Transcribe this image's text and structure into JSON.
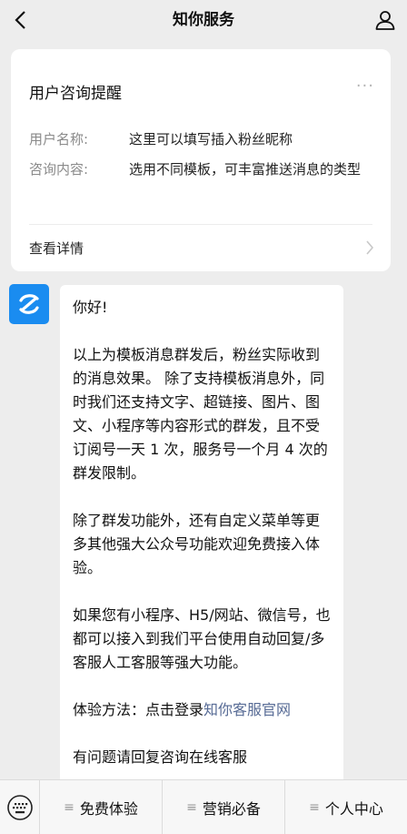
{
  "header": {
    "title": "知你服务"
  },
  "card": {
    "title": "用户咨询提醒",
    "more": "···",
    "fields": [
      {
        "key": "用户名称:",
        "value": "这里可以填写插入粉丝昵称"
      },
      {
        "key": "咨询内容:",
        "value": "选用不同模板，可丰富推送消息的类型"
      }
    ],
    "detail_label": "查看详情"
  },
  "message": {
    "greeting": "你好!",
    "para1": "以上为模板消息群发后，粉丝实际收到的消息效果。 除了支持模板消息外，同时我们还支持文字、超链接、图片、图文、小程序等内容形式的群发，且不受订阅号一天 1 次，服务号一个月 4 次的群发限制。",
    "para2": "除了群发功能外，还有自定义菜单等更多其他强大公众号功能欢迎免费接入体验。",
    "para3": "如果您有小程序、H5/网站、微信号，也都可以接入到我们平台使用自动回复/多客服人工客服等强大功能。",
    "para4_prefix": "体验方法：点击登录",
    "para4_link": "知你客服官网",
    "para5": "有问题请回复咨询在线客服"
  },
  "bottom_menu": {
    "items": [
      {
        "label": "免费体验"
      },
      {
        "label": "营销必备"
      },
      {
        "label": "个人中心"
      }
    ],
    "menu_glyph": "≡"
  },
  "colors": {
    "link": "#576b95",
    "avatar_bg": "#1a8cf0",
    "background": "#ededed"
  }
}
